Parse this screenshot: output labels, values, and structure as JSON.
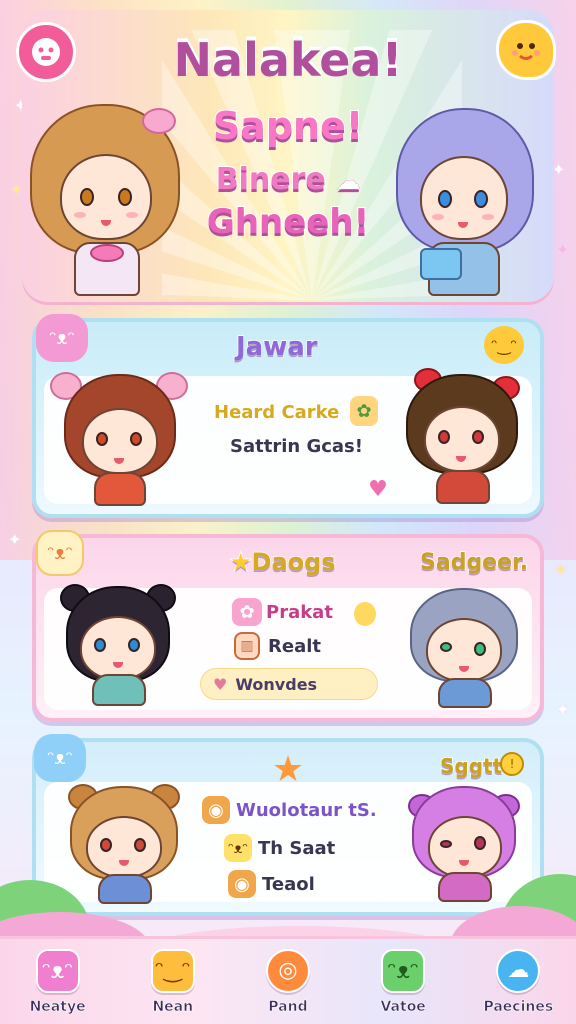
{
  "header": {
    "title_line1": "Nalakea!",
    "title_line2": "Sapne!",
    "title_line3": "Binere",
    "title_line4": "Ghneeh!",
    "left_icon": "pink-blob-face-icon",
    "right_icon": "yellow-chick-face-icon"
  },
  "card1": {
    "title": "Jawar",
    "line1": "Heard Carke",
    "line2": "Sattrin Gcas!",
    "icons": [
      "pink-blob-icon",
      "orange-fruit-icon",
      "food-pot-icon",
      "heart-icon"
    ]
  },
  "card2": {
    "title": "Daogs",
    "title_right": "Sadgeer.",
    "item1": "Prakat",
    "item2": "Realt",
    "pill": "Wonvdes",
    "icons": [
      "pink-blob-icon",
      "star-icon",
      "strawberry-icon",
      "cup-icon",
      "leaf-icon"
    ]
  },
  "card3": {
    "title_right": "Sggtt",
    "line1": "Wuolotaur tS.",
    "line2": "Th Saat",
    "line3": "Teaol",
    "icons": [
      "blue-blob-icon",
      "orange-star-icon",
      "bread-icon",
      "bee-icon",
      "coin-icon"
    ]
  },
  "nav": {
    "items": [
      {
        "label": "Neatye",
        "icon": "pink-blob-icon",
        "color": "#f07fd0"
      },
      {
        "label": "Nean",
        "icon": "orange-cat-icon",
        "color": "#ffbd3e"
      },
      {
        "label": "Pand",
        "icon": "orange-ring-icon",
        "color": "#ff8a3c"
      },
      {
        "label": "Vatoe",
        "icon": "green-frog-icon",
        "color": "#6bcf6b"
      },
      {
        "label": "Paecines",
        "icon": "blue-chat-icon",
        "color": "#48b4f0"
      }
    ]
  },
  "colors": {
    "accent_pink": "#f25d99",
    "accent_yellow": "#ffc93b",
    "card_blue_border": "#aee0f2",
    "card_pink_border": "#f7b8d8"
  }
}
